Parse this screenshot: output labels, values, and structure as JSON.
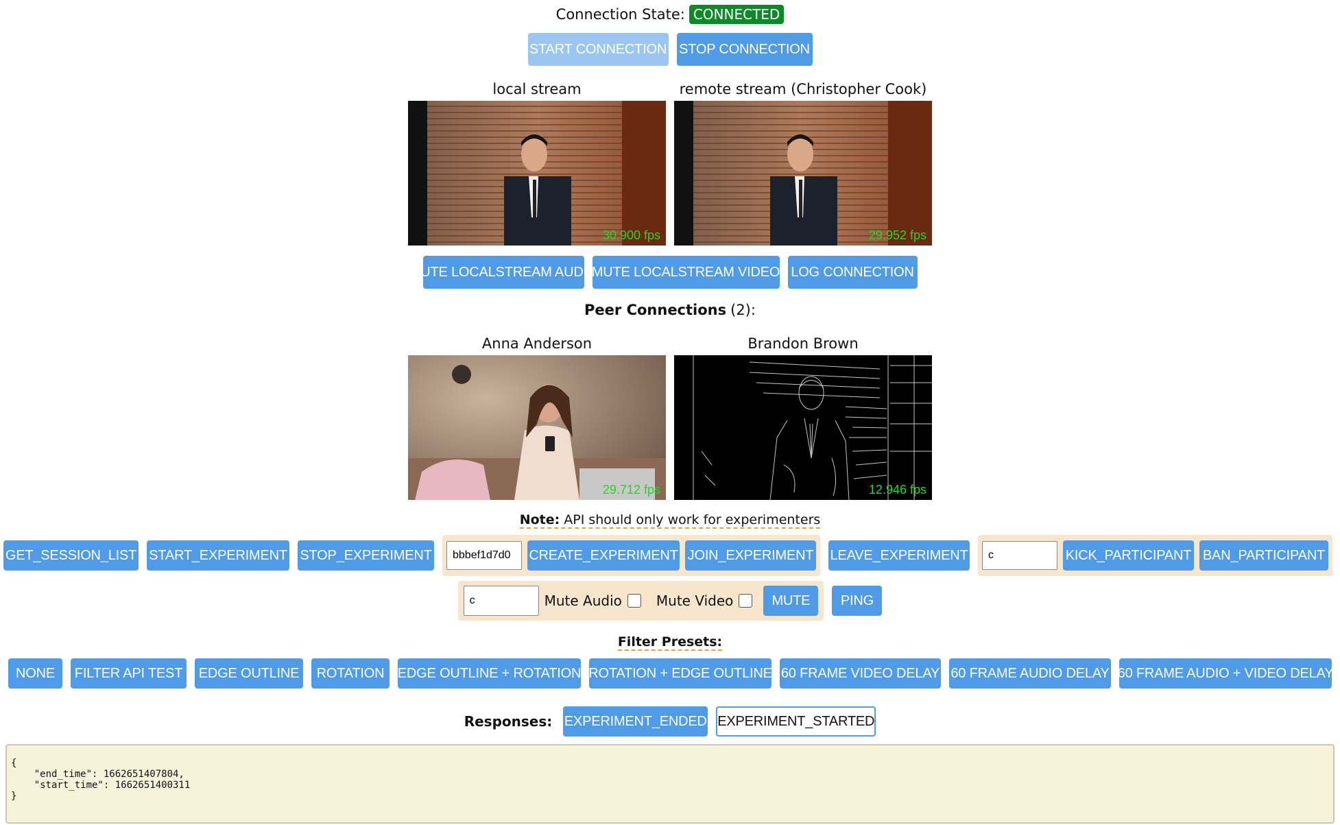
{
  "connection": {
    "label": "Connection State:",
    "state": "CONNECTED",
    "state_color": "#0d8a28"
  },
  "controls": {
    "start": "START CONNECTION",
    "stop": "STOP CONNECTION"
  },
  "streams": {
    "local": {
      "label": "local stream",
      "fps": "30.900 fps"
    },
    "remote": {
      "label": "remote stream (Christopher Cook)",
      "fps": "29.952 fps"
    }
  },
  "stream_buttons": {
    "mute_audio": "MUTE LOCALSTREAM AUDIO",
    "mute_video": "MUTE LOCALSTREAM VIDEO",
    "log": "LOG CONNECTION"
  },
  "peers": {
    "heading": "Peer Connections",
    "count": "(2):",
    "items": [
      {
        "name": "Anna Anderson",
        "fps": "29.712 fps"
      },
      {
        "name": "Brandon Brown",
        "fps": "12.946 fps"
      }
    ]
  },
  "note": {
    "bold": "Note:",
    "text": "API should only work for experimenters"
  },
  "api": {
    "get_session_list": "GET_SESSION_LIST",
    "start_experiment": "START_EXPERIMENT",
    "stop_experiment": "STOP_EXPERIMENT",
    "experiment_id_value": "bbbef1d7d0",
    "create_experiment": "CREATE_EXPERIMENT",
    "join_experiment": "JOIN_EXPERIMENT",
    "leave_experiment": "LEAVE_EXPERIMENT",
    "participant_value": "c",
    "kick": "KICK_PARTICIPANT",
    "ban": "BAN_PARTICIPANT",
    "mute_participant_value": "c",
    "mute_audio_label": "Mute Audio",
    "mute_video_label": "Mute Video",
    "mute": "MUTE",
    "ping": "PING"
  },
  "filters": {
    "heading": "Filter Presets:",
    "items": [
      "NONE",
      "FILTER API TEST",
      "EDGE OUTLINE",
      "ROTATION",
      "EDGE OUTLINE + ROTATION",
      "ROTATION + EDGE OUTLINE",
      "60 FRAME VIDEO DELAY",
      "60 FRAME AUDIO DELAY",
      "60 FRAME AUDIO + VIDEO DELAY"
    ]
  },
  "responses": {
    "label": "Responses:",
    "tabs": [
      "EXPERIMENT_ENDED",
      "EXPERIMENT_STARTED"
    ],
    "json": "{\n    \"end_time\": 1662651407804,\n    \"start_time\": 1662651400311\n}"
  },
  "colors": {
    "accent": "#4f9be8",
    "fps": "#22d822",
    "group_bg": "#f7e6cc",
    "response_bg": "#f5f3d9"
  }
}
